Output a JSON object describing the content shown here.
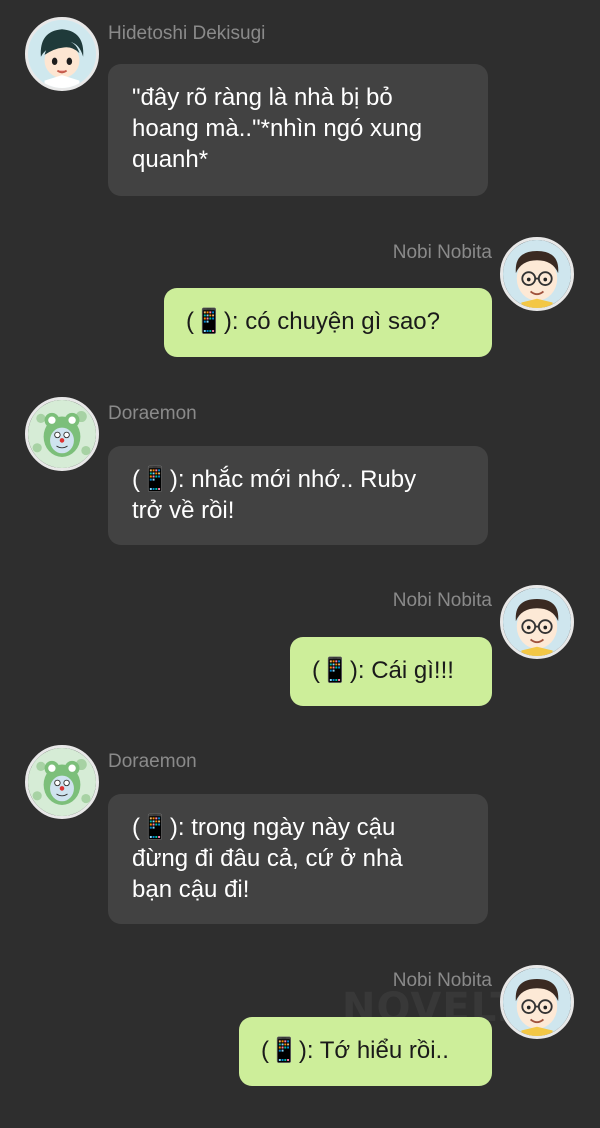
{
  "watermark": "NOVELTO",
  "messages": [
    {
      "sender": "Hidetoshi Dekisugi",
      "side": "left",
      "text": "\"đây rõ ràng là nhà bị bỏ\nhoang mà..\"*nhìn ngó xung\nquanh*",
      "avatar": "dekisugi-avatar"
    },
    {
      "sender": "Nobi Nobita",
      "side": "right",
      "text": "(📱): có chuyện gì sao?",
      "avatar": "nobita-avatar"
    },
    {
      "sender": "Doraemon",
      "side": "left",
      "text": "(📱): nhắc mới nhớ.. Ruby\ntrở về rồi!",
      "avatar": "doraemon-avatar"
    },
    {
      "sender": "Nobi Nobita",
      "side": "right",
      "text": "(📱): Cái gì!!!",
      "avatar": "nobita-avatar"
    },
    {
      "sender": "Doraemon",
      "side": "left",
      "text": "(📱): trong ngày này cậu\nđừng đi đâu cả, cứ ở nhà\nbạn cậu đi!",
      "avatar": "doraemon-avatar"
    },
    {
      "sender": "Nobi Nobita",
      "side": "right",
      "text": "(📱): Tớ hiểu rồi..",
      "avatar": "nobita-avatar"
    }
  ],
  "colors": {
    "background": "#2e2e2e",
    "left_bubble": "#424242",
    "right_bubble": "#cdee9a",
    "name_text": "#8a8a8a"
  }
}
